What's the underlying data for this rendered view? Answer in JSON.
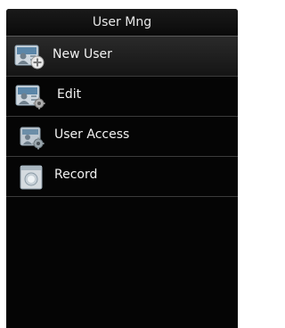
{
  "header": {
    "title": "User Mng"
  },
  "menu": {
    "items": [
      {
        "label": "New User",
        "icon": "add-user-icon"
      },
      {
        "label": "Edit",
        "icon": "edit-user-icon"
      },
      {
        "label": "User Access",
        "icon": "user-access-icon"
      },
      {
        "label": "Record",
        "icon": "record-icon"
      }
    ]
  },
  "colors": {
    "screen_bg": "#050505",
    "text": "#f2f2f2",
    "divider": "#3c3c3c",
    "icon_badge_blue": "#4a90c8"
  }
}
